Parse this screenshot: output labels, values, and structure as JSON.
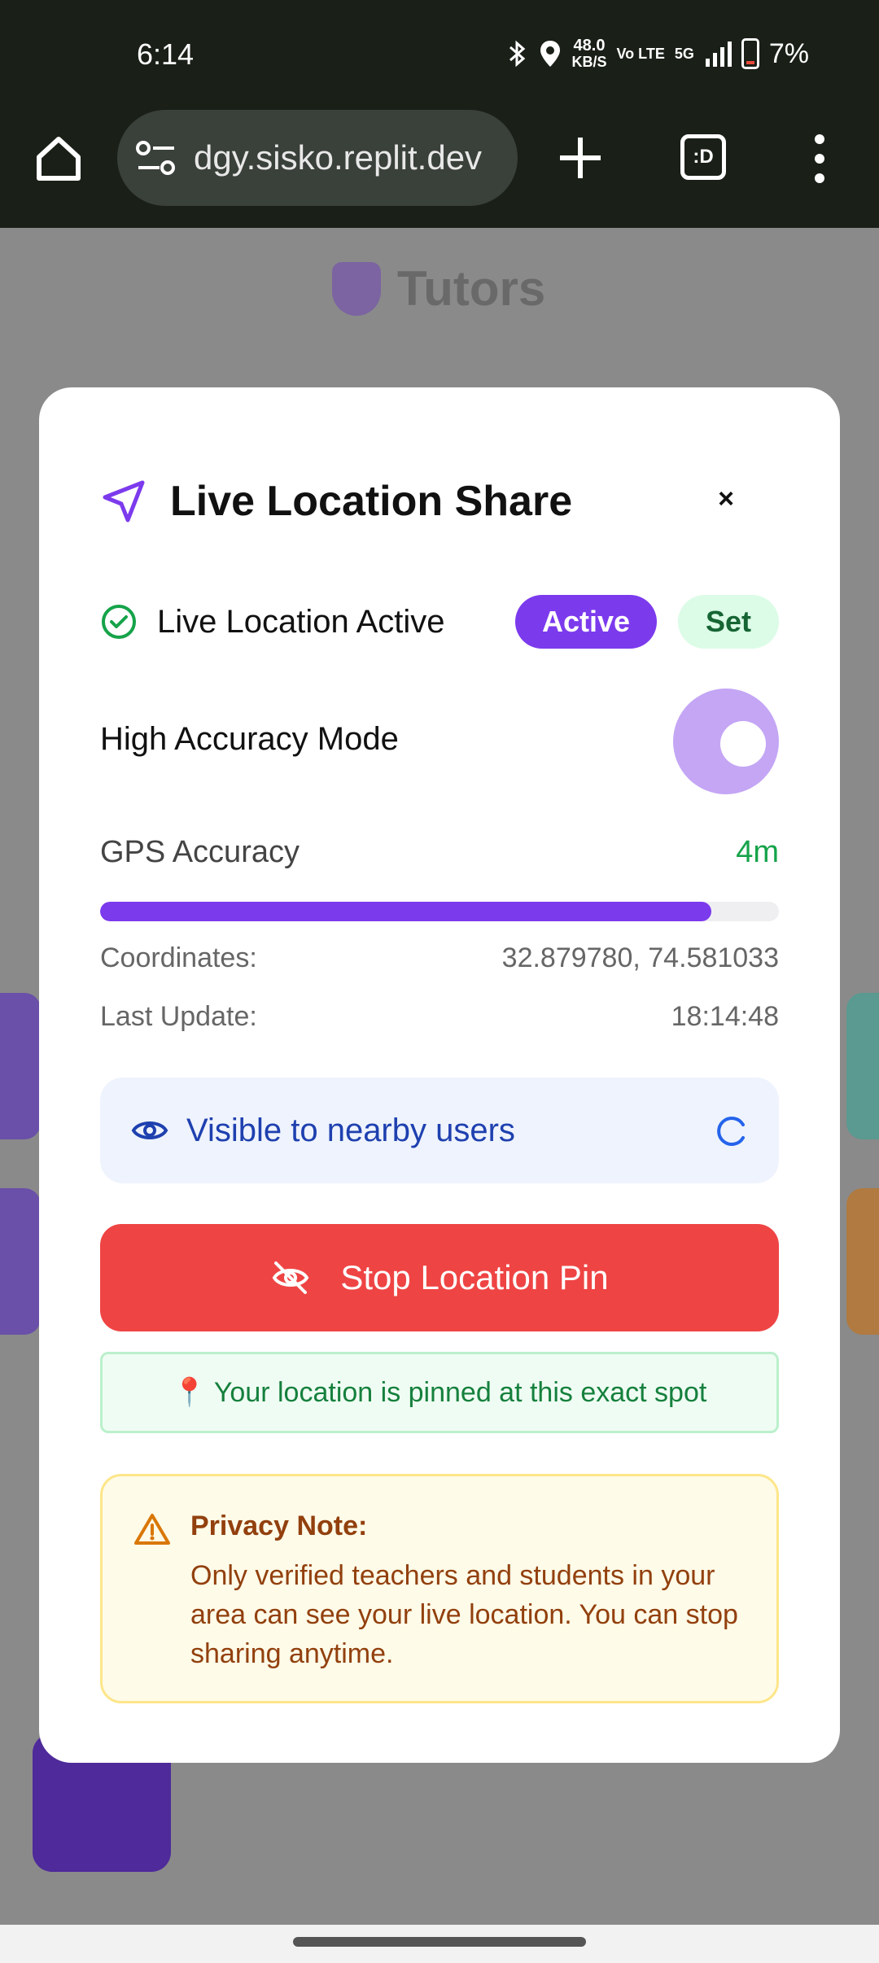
{
  "status_bar": {
    "time": "6:14",
    "net_speed_value": "48.0",
    "net_speed_unit": "KB/S",
    "volte": "Vo LTE",
    "network": "5G",
    "battery": "7%"
  },
  "browser": {
    "url": "dgy.sisko.replit.dev",
    "tabs_label": ":D"
  },
  "background_app": {
    "brand": "Tutors"
  },
  "modal": {
    "title": "Live Location Share",
    "close_label": "×",
    "status_label": "Live Location Active",
    "active_badge": "Active",
    "set_badge": "Set",
    "high_accuracy_label": "High Accuracy Mode",
    "high_accuracy_on": true,
    "gps_label": "GPS Accuracy",
    "gps_value": "4m",
    "gps_progress_fraction": 0.9,
    "coordinates_label": "Coordinates:",
    "coordinates_value": "32.879780, 74.581033",
    "last_update_label": "Last Update:",
    "last_update_value": "18:14:48",
    "visible_text": "Visible to nearby users",
    "stop_button_label": "Stop Location Pin",
    "pinned_text": "📍 Your location is pinned at this exact spot",
    "privacy_title": "Privacy Note:",
    "privacy_body": "Only verified teachers and students in your area can see your live location. You can stop sharing anytime."
  },
  "colors": {
    "accent_purple": "#7c3aed",
    "success_green": "#16a34a",
    "danger_red": "#ef4444",
    "info_blue": "#1e40af",
    "warning_brown": "#92400e"
  }
}
